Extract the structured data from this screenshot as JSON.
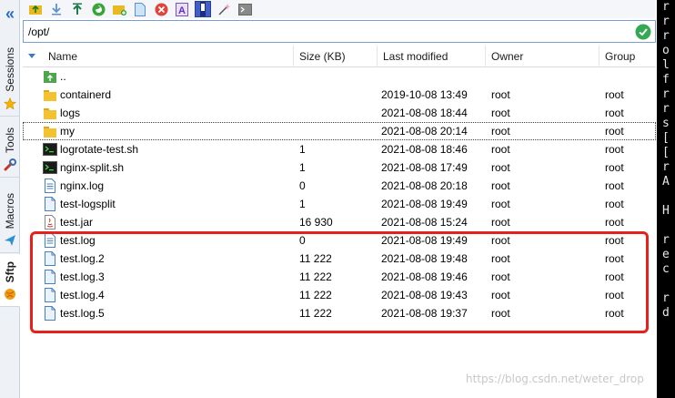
{
  "sidebar": {
    "tabs": [
      {
        "label": "Sessions",
        "icon": "star-icon"
      },
      {
        "label": "Tools",
        "icon": "wrench-icon"
      },
      {
        "label": "Macros",
        "icon": "paper-plane-icon"
      },
      {
        "label": "Sftp",
        "icon": "globe-icon"
      }
    ]
  },
  "toolbar": {
    "buttons": [
      "upload-folder-icon",
      "download-icon",
      "upload-icon",
      "refresh-icon",
      "new-folder-icon",
      "new-file-icon",
      "delete-icon",
      "rename-icon",
      "open-terminal-icon",
      "magic-wand-icon",
      "terminal-icon"
    ]
  },
  "path": {
    "value": "/opt/"
  },
  "columns": {
    "name": "Name",
    "size": "Size (KB)",
    "modified": "Last modified",
    "owner": "Owner",
    "group": "Group"
  },
  "files": [
    {
      "name": "..",
      "size": "",
      "modified": "",
      "owner": "",
      "group": "",
      "icon": "parent-folder-icon"
    },
    {
      "name": "containerd",
      "size": "",
      "modified": "2019-10-08 13:49",
      "owner": "root",
      "group": "root",
      "icon": "folder-icon"
    },
    {
      "name": "logs",
      "size": "",
      "modified": "2021-08-08 18:44",
      "owner": "root",
      "group": "root",
      "icon": "folder-icon"
    },
    {
      "name": "my",
      "size": "",
      "modified": "2021-08-08 20:14",
      "owner": "root",
      "group": "root",
      "icon": "folder-icon"
    },
    {
      "name": "logrotate-test.sh",
      "size": "1",
      "modified": "2021-08-08 18:46",
      "owner": "root",
      "group": "root",
      "icon": "shell-script-icon"
    },
    {
      "name": "nginx-split.sh",
      "size": "1",
      "modified": "2021-08-08 17:49",
      "owner": "root",
      "group": "root",
      "icon": "shell-script-icon"
    },
    {
      "name": "nginx.log",
      "size": "0",
      "modified": "2021-08-08 20:18",
      "owner": "root",
      "group": "root",
      "icon": "text-file-icon"
    },
    {
      "name": "test-logsplit",
      "size": "1",
      "modified": "2021-08-08 19:49",
      "owner": "root",
      "group": "root",
      "icon": "file-icon"
    },
    {
      "name": "test.jar",
      "size": "16 930",
      "modified": "2021-08-08 15:24",
      "owner": "root",
      "group": "root",
      "icon": "jar-file-icon"
    },
    {
      "name": "test.log",
      "size": "0",
      "modified": "2021-08-08 19:49",
      "owner": "root",
      "group": "root",
      "icon": "text-file-icon"
    },
    {
      "name": "test.log.2",
      "size": "11 222",
      "modified": "2021-08-08 19:48",
      "owner": "root",
      "group": "root",
      "icon": "file-icon"
    },
    {
      "name": "test.log.3",
      "size": "11 222",
      "modified": "2021-08-08 19:46",
      "owner": "root",
      "group": "root",
      "icon": "file-icon"
    },
    {
      "name": "test.log.4",
      "size": "11 222",
      "modified": "2021-08-08 19:43",
      "owner": "root",
      "group": "root",
      "icon": "file-icon"
    },
    {
      "name": "test.log.5",
      "size": "11 222",
      "modified": "2021-08-08 19:37",
      "owner": "root",
      "group": "root",
      "icon": "file-icon"
    }
  ],
  "terminal_lines": [
    "r",
    "r",
    "r",
    "o",
    "l",
    "f",
    "r",
    "r",
    "s",
    "[",
    "[",
    "r",
    "A",
    "",
    "H",
    "",
    "r",
    "e",
    "c",
    "",
    "r",
    "d"
  ],
  "watermark": "https://blog.csdn.net/weter_drop",
  "colors": {
    "highlight": "#e8201c",
    "accent": "#3a78c9",
    "folder": "#f2c230"
  }
}
